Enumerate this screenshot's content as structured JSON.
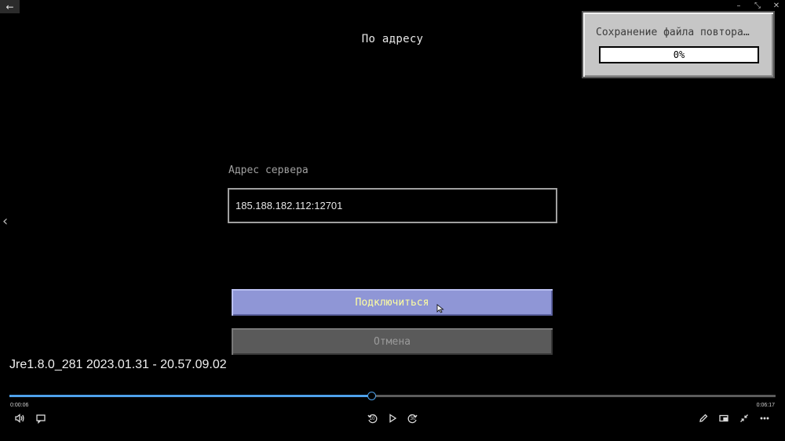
{
  "screen": {
    "title": "По адресу",
    "field_label": "Адрес сервера",
    "address_value": "185.188.182.112:12701",
    "connect_label": "Подключиться",
    "cancel_label": "Отмена"
  },
  "toast": {
    "title": "Сохранение файла повтора…",
    "progress_text": "0%",
    "progress": 0
  },
  "player": {
    "video_title": "Jre1.8.0_281 2023.01.31 - 20.57.09.02",
    "time_current": "0:00:06",
    "time_total": "0:06:17",
    "progress_fraction": 0.472,
    "skip_back_label": "10",
    "skip_fwd_label": "30"
  },
  "icons": {
    "back": "back-arrow-icon",
    "minimize": "minimize-icon",
    "restore": "restore-icon",
    "close": "close-icon",
    "volume": "volume-icon",
    "subtitles": "subtitles-icon",
    "skip_back": "skip-back-10-icon",
    "play": "play-icon",
    "skip_forward": "skip-forward-30-icon",
    "edit": "pen-icon",
    "miniview": "miniview-icon",
    "exit_fullscreen": "exit-fullscreen-icon",
    "more": "more-icon"
  },
  "colors": {
    "accent": "#4ea1ea",
    "connect_text": "#ffffa0",
    "progress_fill": "#80ff80"
  }
}
